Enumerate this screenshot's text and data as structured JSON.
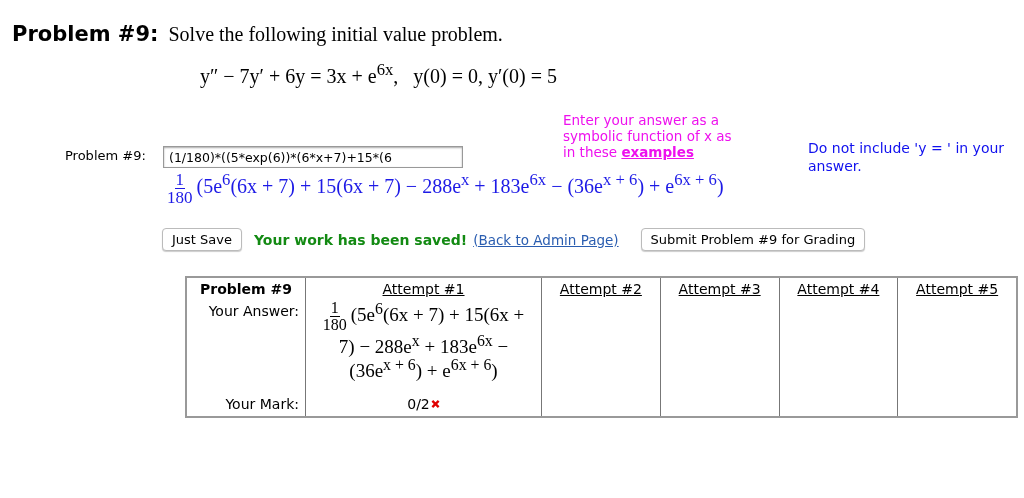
{
  "problem": {
    "heading": "Problem #9:",
    "prompt": "Solve the following initial value problem.",
    "equation": "y″ − 7y′ + 6y = 3x + e$^{6x}$,   y(0) = 0, y′(0) = 5"
  },
  "answer_entry": {
    "label": "Problem #9:",
    "input_value": "(1/180)*((5*exp(6))*(6*x+7)+15*(6",
    "preview": {
      "fraction": {
        "numerator": "1",
        "denominator": "180"
      },
      "expression": "(5e$^{6}$(6x + 7) + 15(6x + 7) − 288e$^{x}$ + 183e$^{6x}$ − (36e$^{x + 6}$) + e$^{6x + 6}$)"
    },
    "hint": "Enter your answer as a symbolic function of x as in these",
    "hint_link": "examples",
    "note": "Do not include 'y = ' in your answer."
  },
  "actions": {
    "save_button": "Just Save",
    "status": "Your work has been saved!",
    "back_link": "(Back to Admin Page)",
    "submit_button": "Submit Problem #9 for Grading"
  },
  "attempts_table": {
    "header": "Problem #9",
    "answer_label": "Your Answer:",
    "mark_label": "Your Mark:",
    "columns": [
      {
        "label": "Attempt #1"
      },
      {
        "label": "Attempt #2"
      },
      {
        "label": "Attempt #3"
      },
      {
        "label": "Attempt #4"
      },
      {
        "label": "Attempt #5"
      }
    ],
    "attempts": [
      {
        "answer": {
          "fraction": {
            "numerator": "1",
            "denominator": "180"
          },
          "expression": "(5e$^{6}$(6x + 7) + 15(6x + 7) − 288e$^{x}$ + 183e$^{6x}$ − (36e$^{x + 6}$) + e$^{6x + 6}$)"
        },
        "mark": "0/2",
        "correct": false
      }
    ]
  }
}
